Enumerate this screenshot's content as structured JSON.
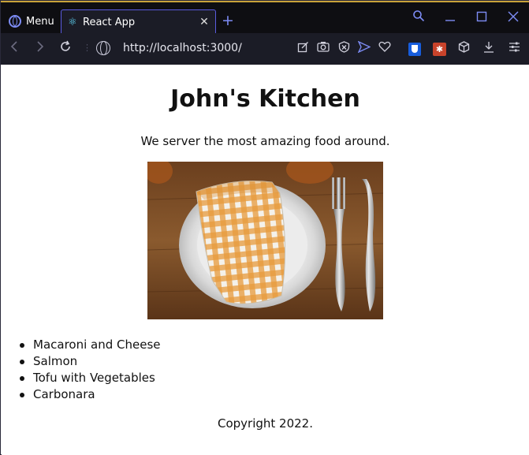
{
  "browser": {
    "menu_label": "Menu",
    "tab_title": "React App",
    "url": "http://localhost:3000/"
  },
  "page": {
    "title": "John's Kitchen",
    "tagline": "We server the most amazing food around.",
    "menu_items": [
      "Macaroni and Cheese",
      "Salmon",
      "Tofu with Vegetables",
      "Carbonara"
    ],
    "copyright": "Copyright 2022."
  },
  "colors": {
    "chrome_bg": "#0e0e12",
    "toolbar_bg": "#1b1c26",
    "accent": "#7d8cf5"
  }
}
